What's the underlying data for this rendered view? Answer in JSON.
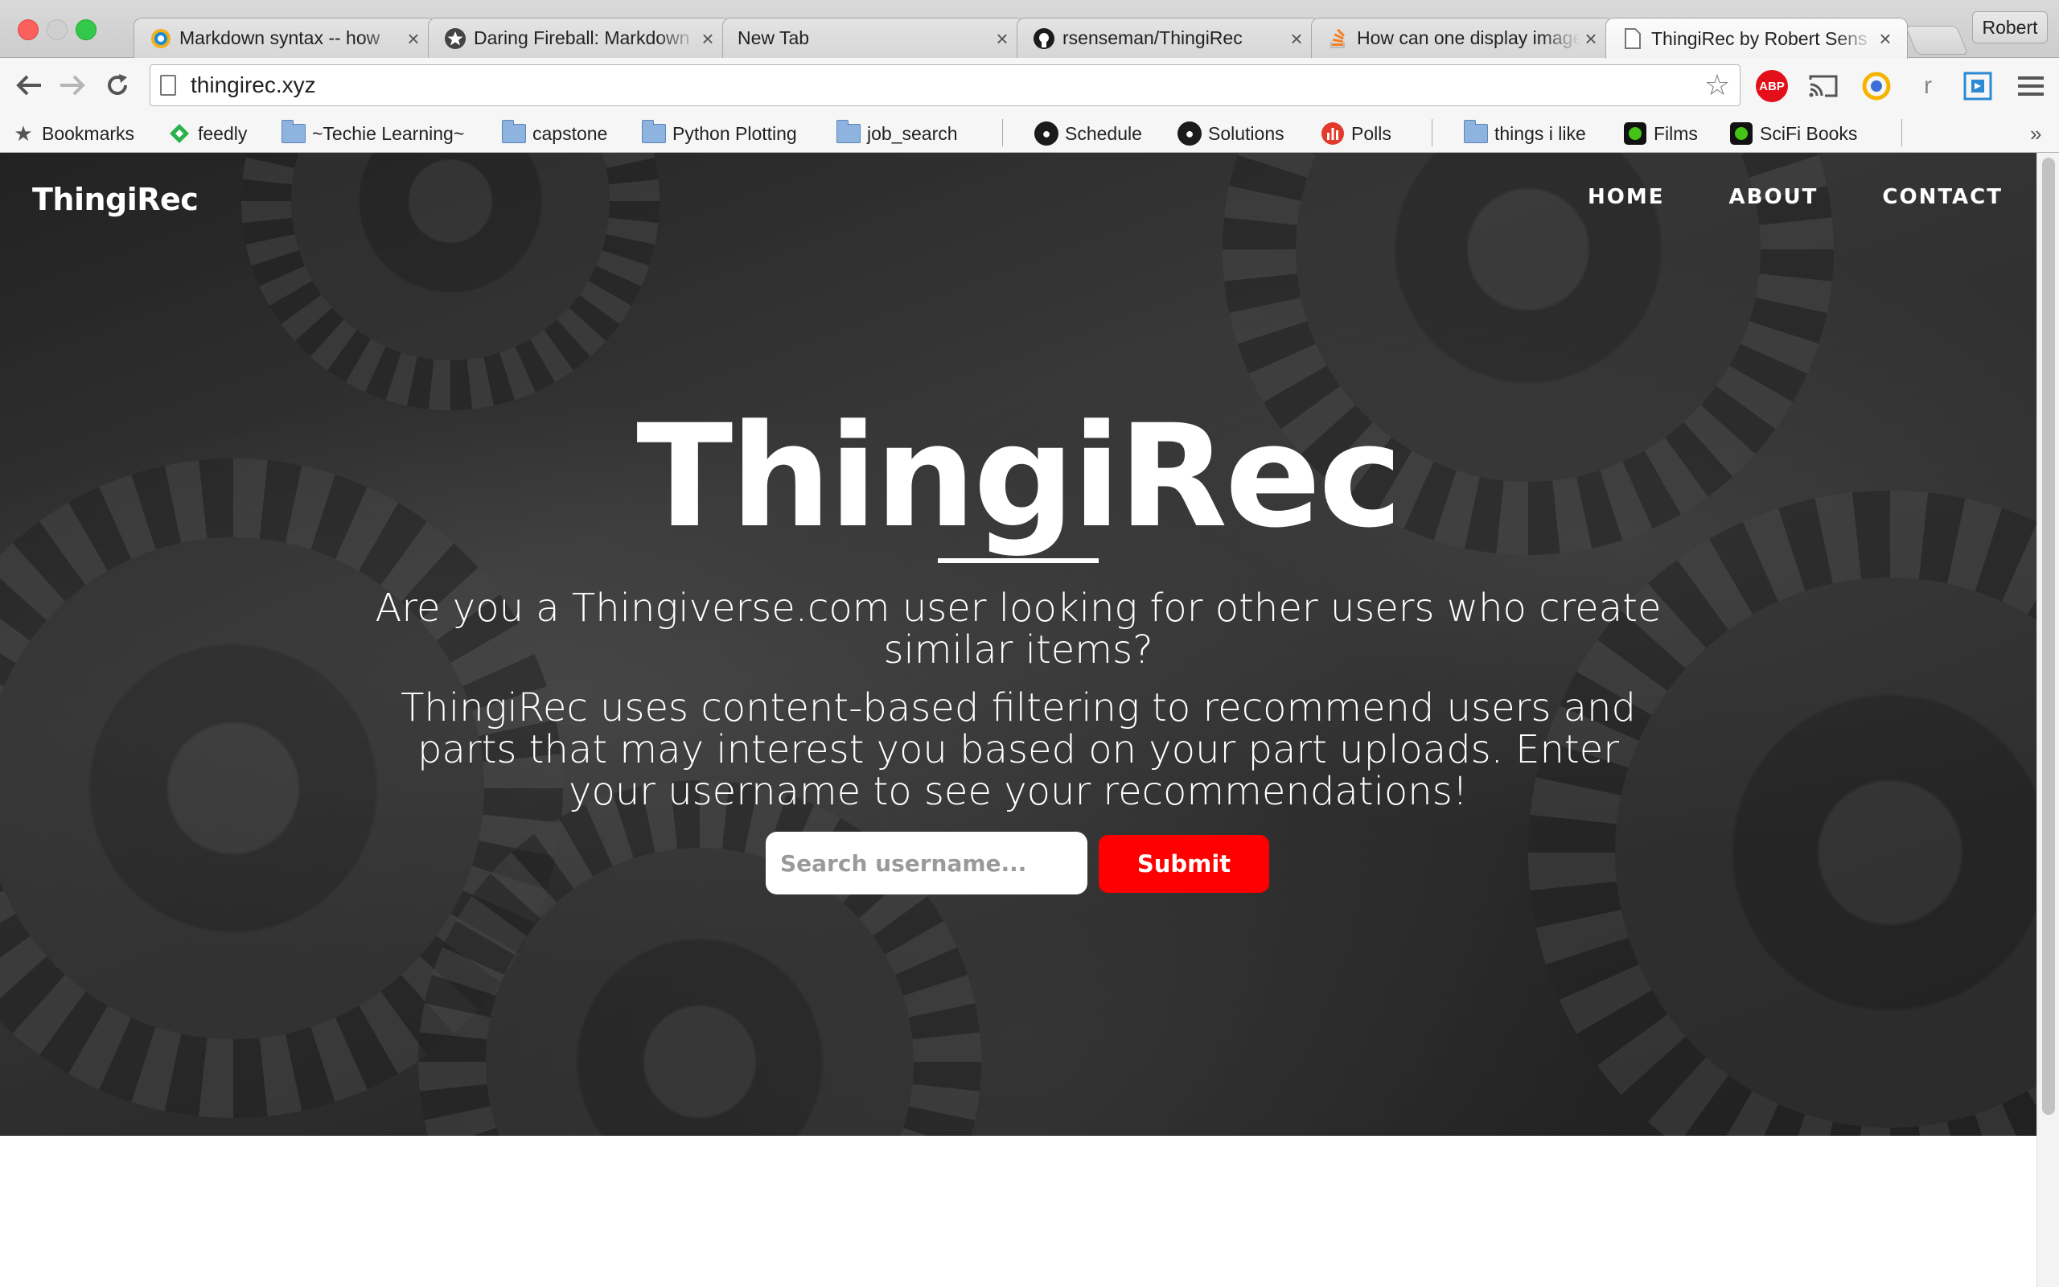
{
  "browser": {
    "tabs": [
      {
        "title": "Markdown syntax -- how",
        "icon": "chat-bubble-icon",
        "active": false
      },
      {
        "title": "Daring Fireball: Markdown",
        "icon": "star-circle-icon",
        "active": false
      },
      {
        "title": "New Tab",
        "icon": "",
        "active": false
      },
      {
        "title": "rsenseman/ThingiRec",
        "icon": "github-icon",
        "active": false
      },
      {
        "title": "How can one display image",
        "icon": "stackoverflow-icon",
        "active": false
      },
      {
        "title": "ThingiRec by Robert Sens",
        "icon": "page-icon",
        "active": true
      }
    ],
    "profile_name": "Robert",
    "url": "thingirec.xyz",
    "extensions": {
      "abp_label": "ABP",
      "r_label": "r"
    },
    "bookmarks": [
      {
        "label": "Bookmarks",
        "icon": "star-icon"
      },
      {
        "label": "feedly",
        "icon": "feedly-icon"
      },
      {
        "label": "~Techie Learning~",
        "icon": "folder-icon"
      },
      {
        "label": "capstone",
        "icon": "folder-icon"
      },
      {
        "label": "Python Plotting",
        "icon": "folder-icon"
      },
      {
        "label": "job_search",
        "icon": "folder-icon"
      },
      {
        "label": "Schedule",
        "icon": "github-icon"
      },
      {
        "label": "Solutions",
        "icon": "github-icon"
      },
      {
        "label": "Polls",
        "icon": "polls-icon"
      },
      {
        "label": "things i like",
        "icon": "folder-icon"
      },
      {
        "label": "Films",
        "icon": "green-circle-icon"
      },
      {
        "label": "SciFi Books",
        "icon": "green-circle-icon"
      }
    ],
    "more_bookmarks": "»"
  },
  "site": {
    "brand": "ThingiRec",
    "nav": [
      "HOME",
      "ABOUT",
      "CONTACT"
    ],
    "hero_title": "ThingiRec",
    "lead_1": "Are you a Thingiverse.com user looking for other users who create similar items?",
    "lead_2": "ThingiRec uses content-based filtering to recommend users and parts that may interest you based on your part uploads. Enter your username to see your recommendations!",
    "search_placeholder": "Search username...",
    "submit_label": "Submit"
  },
  "colors": {
    "accent": "#ff0000"
  }
}
